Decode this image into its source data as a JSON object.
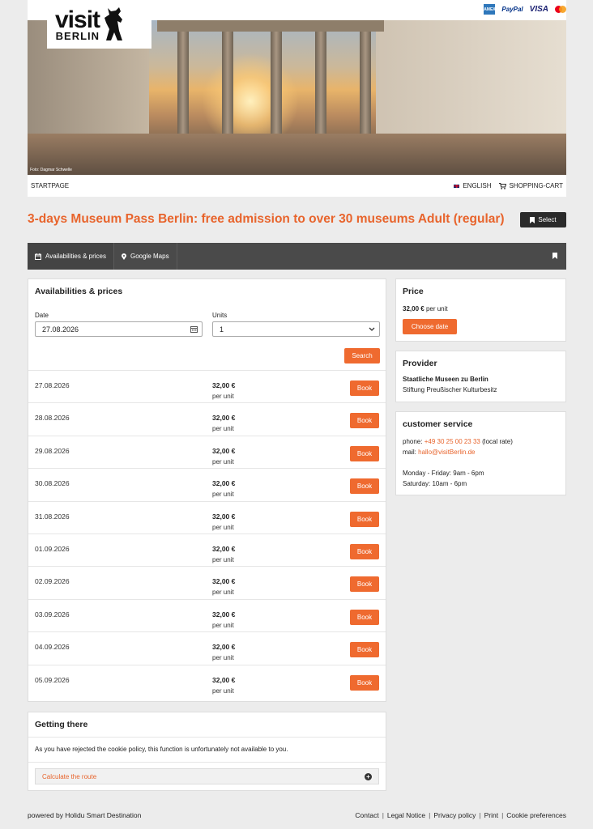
{
  "header": {
    "logo_visit": "visit",
    "logo_berlin": "BERLIN",
    "payments": {
      "amex": "AMEX",
      "paypal": "PayPal",
      "visa": "VISA"
    },
    "photo_credit": "Foto: Dagmar Schwelle"
  },
  "nav": {
    "start": "STARTPAGE",
    "language": "ENGLISH",
    "cart": "SHOPPING-CART"
  },
  "title": "3-days Museum Pass Berlin: free admission to over 30 museums Adult (regular)",
  "select_label": "Select",
  "tabs": [
    {
      "label": "Availabilities & prices",
      "icon": "calendar-icon"
    },
    {
      "label": "Google Maps",
      "icon": "map-pin-icon"
    }
  ],
  "availability": {
    "title": "Availabilities & prices",
    "date_label": "Date",
    "date_value": "27.08.2026",
    "units_label": "Units",
    "units_value": "1",
    "search_label": "Search",
    "book_label": "Book",
    "rows": [
      {
        "date": "27.08.2026",
        "price": "32,00 €",
        "unit": "per unit"
      },
      {
        "date": "28.08.2026",
        "price": "32,00 €",
        "unit": "per unit"
      },
      {
        "date": "29.08.2026",
        "price": "32,00 €",
        "unit": "per unit"
      },
      {
        "date": "30.08.2026",
        "price": "32,00 €",
        "unit": "per unit"
      },
      {
        "date": "31.08.2026",
        "price": "32,00 €",
        "unit": "per unit"
      },
      {
        "date": "01.09.2026",
        "price": "32,00 €",
        "unit": "per unit"
      },
      {
        "date": "02.09.2026",
        "price": "32,00 €",
        "unit": "per unit"
      },
      {
        "date": "03.09.2026",
        "price": "32,00 €",
        "unit": "per unit"
      },
      {
        "date": "04.09.2026",
        "price": "32,00 €",
        "unit": "per unit"
      },
      {
        "date": "05.09.2026",
        "price": "32,00 €",
        "unit": "per unit"
      }
    ]
  },
  "price_box": {
    "title": "Price",
    "amount": "32,00 €",
    "unit": "per unit",
    "choose_label": "Choose date"
  },
  "provider_box": {
    "title": "Provider",
    "name": "Staatliche Museen zu Berlin",
    "org": "Stiftung Preußischer Kulturbesitz"
  },
  "service_box": {
    "title": "customer service",
    "phone_label": "phone:",
    "phone": "+49 30 25 00 23 33",
    "phone_note": "(local rate)",
    "mail_label": "mail:",
    "mail": "hallo@visitBerlin.de",
    "hours1": "Monday - Friday: 9am - 6pm",
    "hours2": "Saturday: 10am - 6pm"
  },
  "getting": {
    "title": "Getting there",
    "note": "As you have rejected the cookie policy, this function is unfortunately not available to you.",
    "route_label": "Calculate the route"
  },
  "footer": {
    "powered": "powered by Holidu Smart Destination",
    "links": [
      "Contact",
      "Legal Notice",
      "Privacy policy",
      "Print",
      "Cookie preferences"
    ]
  },
  "colors": {
    "accent": "#ef6a2f",
    "dark": "#4a4a4a"
  }
}
